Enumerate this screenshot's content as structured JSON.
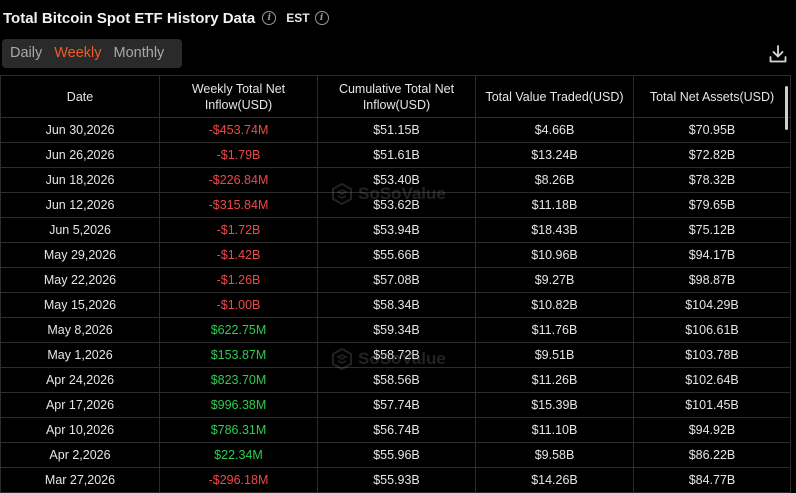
{
  "header": {
    "title": "Total Bitcoin Spot ETF History Data",
    "timezone": "EST"
  },
  "tabs": [
    {
      "label": "Daily",
      "active": false
    },
    {
      "label": "Weekly",
      "active": true
    },
    {
      "label": "Monthly",
      "active": false
    }
  ],
  "watermark": "SoSoValue",
  "table": {
    "columns": [
      "Date",
      "Weekly Total Net Inflow(USD)",
      "Cumulative Total Net Inflow(USD)",
      "Total Value Traded(USD)",
      "Total Net Assets(USD)"
    ],
    "rows": [
      {
        "date": "Jun 30,2026",
        "inflow": "-$453.74M",
        "dir": "neg",
        "cumulative": "$51.15B",
        "traded": "$4.66B",
        "assets": "$70.95B"
      },
      {
        "date": "Jun 26,2026",
        "inflow": "-$1.79B",
        "dir": "neg",
        "cumulative": "$51.61B",
        "traded": "$13.24B",
        "assets": "$72.82B"
      },
      {
        "date": "Jun 18,2026",
        "inflow": "-$226.84M",
        "dir": "neg",
        "cumulative": "$53.40B",
        "traded": "$8.26B",
        "assets": "$78.32B"
      },
      {
        "date": "Jun 12,2026",
        "inflow": "-$315.84M",
        "dir": "neg",
        "cumulative": "$53.62B",
        "traded": "$11.18B",
        "assets": "$79.65B"
      },
      {
        "date": "Jun 5,2026",
        "inflow": "-$1.72B",
        "dir": "neg",
        "cumulative": "$53.94B",
        "traded": "$18.43B",
        "assets": "$75.12B"
      },
      {
        "date": "May 29,2026",
        "inflow": "-$1.42B",
        "dir": "neg",
        "cumulative": "$55.66B",
        "traded": "$10.96B",
        "assets": "$94.17B"
      },
      {
        "date": "May 22,2026",
        "inflow": "-$1.26B",
        "dir": "neg",
        "cumulative": "$57.08B",
        "traded": "$9.27B",
        "assets": "$98.87B"
      },
      {
        "date": "May 15,2026",
        "inflow": "-$1.00B",
        "dir": "neg",
        "cumulative": "$58.34B",
        "traded": "$10.82B",
        "assets": "$104.29B"
      },
      {
        "date": "May 8,2026",
        "inflow": "$622.75M",
        "dir": "pos",
        "cumulative": "$59.34B",
        "traded": "$11.76B",
        "assets": "$106.61B"
      },
      {
        "date": "May 1,2026",
        "inflow": "$153.87M",
        "dir": "pos",
        "cumulative": "$58.72B",
        "traded": "$9.51B",
        "assets": "$103.78B"
      },
      {
        "date": "Apr 24,2026",
        "inflow": "$823.70M",
        "dir": "pos",
        "cumulative": "$58.56B",
        "traded": "$11.26B",
        "assets": "$102.64B"
      },
      {
        "date": "Apr 17,2026",
        "inflow": "$996.38M",
        "dir": "pos",
        "cumulative": "$57.74B",
        "traded": "$15.39B",
        "assets": "$101.45B"
      },
      {
        "date": "Apr 10,2026",
        "inflow": "$786.31M",
        "dir": "pos",
        "cumulative": "$56.74B",
        "traded": "$11.10B",
        "assets": "$94.92B"
      },
      {
        "date": "Apr 2,2026",
        "inflow": "$22.34M",
        "dir": "pos",
        "cumulative": "$55.96B",
        "traded": "$9.58B",
        "assets": "$86.22B"
      },
      {
        "date": "Mar 27,2026",
        "inflow": "-$296.18M",
        "dir": "neg",
        "cumulative": "$55.93B",
        "traded": "$14.26B",
        "assets": "$84.77B"
      }
    ]
  },
  "colors": {
    "negative": "#f04848",
    "positive": "#2ecc50",
    "accent": "#f05a28"
  }
}
